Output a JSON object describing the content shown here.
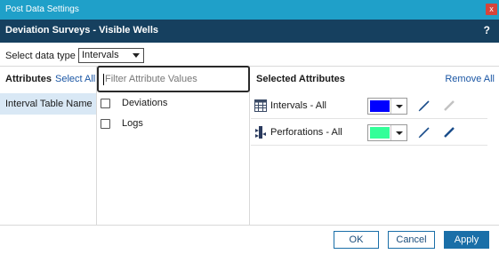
{
  "window": {
    "title": "Post Data Settings",
    "close_label": "x"
  },
  "header": {
    "title": "Deviation Surveys - Visible Wells",
    "help_label": "?"
  },
  "data_type": {
    "label": "Select data type",
    "selected": "Intervals"
  },
  "attributes": {
    "header": "Attributes",
    "select_all": "Select All",
    "items": [
      {
        "label": "Interval Table Name",
        "selected": true
      }
    ]
  },
  "values": {
    "filter_placeholder": "Filter Attribute Values",
    "items": [
      {
        "label": "Deviations",
        "checked": false
      },
      {
        "label": "Logs",
        "checked": false
      }
    ]
  },
  "selected_attributes": {
    "header": "Selected Attributes",
    "remove_all": "Remove All",
    "rows": [
      {
        "label": "Intervals - All",
        "icon": "table-icon",
        "color": "#0000ff"
      },
      {
        "label": "Perforations - All",
        "icon": "perforation-icon",
        "color": "#33ff99"
      }
    ]
  },
  "buttons": {
    "ok": "OK",
    "cancel": "Cancel",
    "apply": "Apply"
  },
  "colors": {
    "titlebar": "#1fa0c9",
    "header": "#16405f",
    "accent": "#1a6fa8",
    "selected_row": "#d9e8f5"
  }
}
